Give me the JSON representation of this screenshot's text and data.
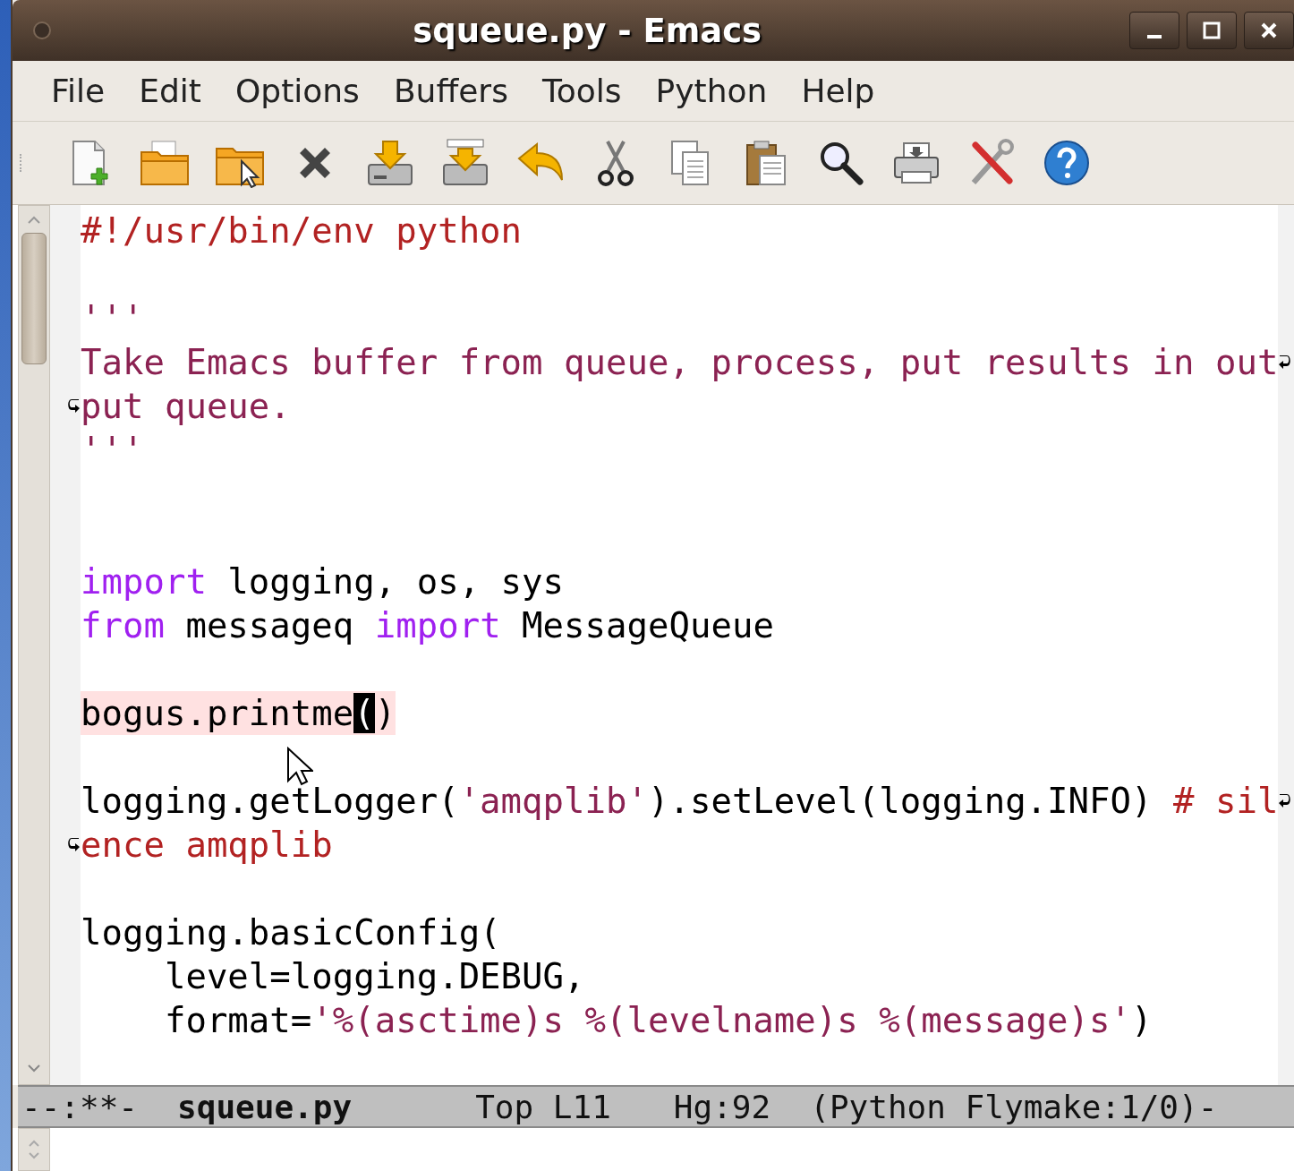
{
  "window": {
    "title": "squeue.py - Emacs"
  },
  "menu": [
    "File",
    "Edit",
    "Options",
    "Buffers",
    "Tools",
    "Python",
    "Help"
  ],
  "buffer": {
    "lines": [
      {
        "tokens": [
          {
            "kind": "comment",
            "text": "#!/usr/bin/env python"
          }
        ],
        "continues": false,
        "continuation": false,
        "current": false
      },
      {
        "continues": false,
        "continuation": false,
        "current": false
      },
      {
        "tokens": [
          {
            "kind": "string",
            "text": "'''"
          }
        ],
        "continues": false,
        "continuation": false,
        "current": false
      },
      {
        "tokens": [
          {
            "kind": "string",
            "text": "Take Emacs buffer from queue, process, put results in out"
          }
        ],
        "continues": true,
        "continuation": false,
        "current": false
      },
      {
        "tokens": [
          {
            "kind": "string",
            "text": "put queue."
          }
        ],
        "continues": false,
        "continuation": true,
        "current": false
      },
      {
        "tokens": [
          {
            "kind": "string",
            "text": "'''"
          }
        ],
        "continues": false,
        "continuation": false,
        "current": false
      },
      {
        "continues": false,
        "continuation": false,
        "current": false
      },
      {
        "continues": false,
        "continuation": false,
        "current": false
      },
      {
        "tokens": [
          {
            "kind": "keyword",
            "text": "import"
          },
          {
            "kind": "plain",
            "text": " logging, os, sys"
          }
        ],
        "continues": false,
        "continuation": false,
        "current": false
      },
      {
        "tokens": [
          {
            "kind": "keyword",
            "text": "from"
          },
          {
            "kind": "plain",
            "text": " messageq "
          },
          {
            "kind": "keyword",
            "text": "import"
          },
          {
            "kind": "plain",
            "text": " MessageQueue"
          }
        ],
        "continues": false,
        "continuation": false,
        "current": false
      },
      {
        "continues": false,
        "continuation": false,
        "current": false
      },
      {
        "tokens": [
          {
            "kind": "plain",
            "text": "bogus.printme"
          },
          {
            "kind": "cursor",
            "text": "("
          },
          {
            "kind": "plain",
            "text": ")"
          }
        ],
        "continues": false,
        "continuation": false,
        "current": true
      },
      {
        "continues": false,
        "continuation": false,
        "current": false
      },
      {
        "tokens": [
          {
            "kind": "plain",
            "text": "logging.getLogger("
          },
          {
            "kind": "string",
            "text": "'amqplib'"
          },
          {
            "kind": "plain",
            "text": ").setLevel(logging.INFO) "
          },
          {
            "kind": "comment",
            "text": "# sil"
          }
        ],
        "continues": true,
        "continuation": false,
        "current": false
      },
      {
        "tokens": [
          {
            "kind": "comment",
            "text": "ence amqplib"
          }
        ],
        "continues": false,
        "continuation": true,
        "current": false
      },
      {
        "continues": false,
        "continuation": false,
        "current": false
      },
      {
        "tokens": [
          {
            "kind": "plain",
            "text": "logging.basicConfig("
          }
        ],
        "continues": false,
        "continuation": false,
        "current": false
      },
      {
        "tokens": [
          {
            "kind": "plain",
            "text": "    level=logging.DEBUG,"
          }
        ],
        "continues": false,
        "continuation": false,
        "current": false
      },
      {
        "tokens": [
          {
            "kind": "plain",
            "text": "    format="
          },
          {
            "kind": "string",
            "text": "'%(asctime)s %(levelname)s %(message)s'"
          },
          {
            "kind": "plain",
            "text": ")"
          }
        ],
        "continues": false,
        "continuation": false,
        "current": false
      }
    ]
  },
  "mode_line": {
    "status": "--:**-",
    "buffer_name": "squeue.py",
    "position": "Top L11",
    "vc": "Hg:92",
    "modes": "(Python Flymake:1/0)-"
  }
}
